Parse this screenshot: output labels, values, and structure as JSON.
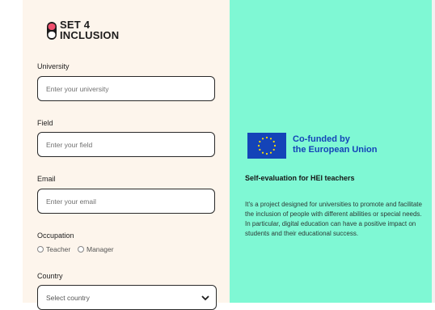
{
  "brand": {
    "line1": "SET 4",
    "line2": "INCLUSION"
  },
  "form": {
    "university": {
      "label": "University",
      "placeholder": "Enter your university"
    },
    "field": {
      "label": "Field",
      "placeholder": "Enter your field"
    },
    "email": {
      "label": "Email",
      "placeholder": "Enter your email"
    },
    "occupation": {
      "label": "Occupation",
      "options": [
        "Teacher",
        "Manager"
      ]
    },
    "country": {
      "label": "Country",
      "selected": "Select country"
    }
  },
  "sidebar": {
    "funding_line1": "Co-funded by",
    "funding_line2": "the European Union",
    "heading": "Self-evaluation for HEI teachers",
    "description": "It's a project designed for universities to promote and facilitate the inclusion of people with different abilities or special needs. In particular, digital education can have a positive impact on students and their educational success."
  },
  "colors": {
    "form_bg": "#fdf5ec",
    "right_bg": "#7ff8d4",
    "eu_blue": "#1444b8",
    "logo_red": "#f0506e"
  },
  "icons": {
    "logo": "set4inclusion-logo-icon",
    "flag": "eu-flag-icon",
    "chevron": "chevron-down-icon"
  }
}
